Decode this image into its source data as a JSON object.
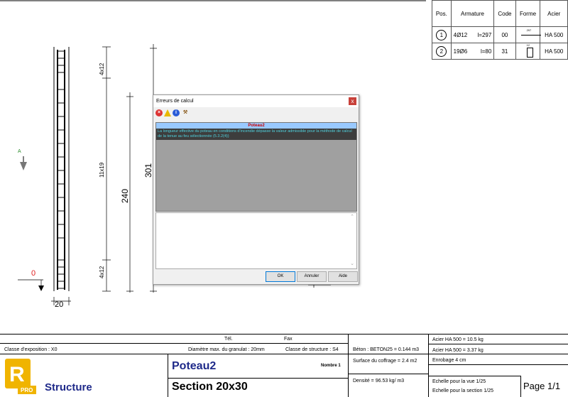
{
  "rebar_table": {
    "headers": [
      "Pos.",
      "Armature",
      "Code",
      "Forme",
      "Acier"
    ],
    "rows": [
      {
        "pos": "1",
        "diameter": "4Ø12",
        "length": "l=297",
        "code": "00",
        "shape_label": "297",
        "steel": "HA 500"
      },
      {
        "pos": "2",
        "diameter": "19Ø6",
        "length": "l=80",
        "code": "31",
        "shape_label": "12",
        "steel": "HA 500"
      }
    ]
  },
  "drawing": {
    "zone_top": "4x12",
    "zone_middle": "11x19",
    "zone_bottom": "4x12",
    "dim_inner": "240",
    "dim_total": "301",
    "width_dim": "20",
    "section_mark": "A",
    "level_mark": "0"
  },
  "dialog": {
    "title": "Erreurs de calcul",
    "close": "x",
    "error_header": "Poteau2",
    "error_message": "La longueur effective du poteau en conditions d'incendie dépasse la valeur admissible pour la méthode de calcul de la tenue au feu sélectionnée (5.3.2(4))",
    "ok_label": "OK",
    "cancel_label": "Annuler",
    "help_label": "Aide"
  },
  "title_block": {
    "tel": "Tél.",
    "fax": "Fax",
    "exposure_class": "Classe d'exposition : X0",
    "aggregate": "Diamètre max. du granulat : 20mm",
    "structure_class": "Classe de structure : S4",
    "concrete": "Béton : BETON25 = 0.144 m3",
    "formwork": "Surface du coffrage = 2.4 m2",
    "density": "Densité = 96.53 kg/ m3",
    "steel_1": "Acier HA 500 = 10.5 kg",
    "steel_2": "Acier HA 500 = 3.37 kg",
    "cover": "Enrobage 4 cm",
    "scale_view": "Echelle pour la vue 1/25",
    "scale_section": "Echelle pour la section 1/25",
    "element_name": "Poteau2",
    "count": "Nombre 1",
    "section": "Section 20x30",
    "app_name": "Structure",
    "logo_pro": "PRO",
    "page": "Page 1/1"
  }
}
